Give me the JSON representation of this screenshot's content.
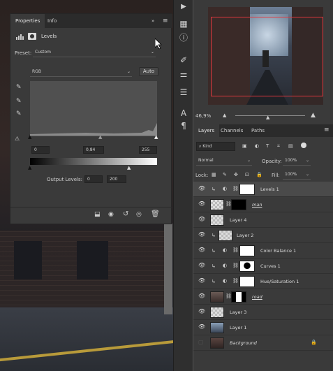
{
  "properties": {
    "tabs": [
      {
        "label": "Properties"
      },
      {
        "label": "Info"
      }
    ],
    "title": "Levels",
    "preset_label": "Preset:",
    "preset_value": "Custom",
    "channel": "RGB",
    "auto_label": "Auto",
    "input_levels": {
      "black": "0",
      "gamma": "0,84",
      "white": "255"
    },
    "output_label": "Output Levels:",
    "output_levels": {
      "black": "0",
      "white": "200"
    }
  },
  "navigator": {
    "zoom": "46,9%"
  },
  "layers_panel": {
    "tabs": [
      {
        "label": "Layers"
      },
      {
        "label": "Channels"
      },
      {
        "label": "Paths"
      }
    ],
    "filter_kind": "Kind",
    "blend_mode": "Normal",
    "opacity_label": "Opacity:",
    "opacity_value": "100%",
    "lock_label": "Lock:",
    "fill_label": "Fill:",
    "fill_value": "100%",
    "layers": [
      {
        "name": "Levels 1"
      },
      {
        "name": "man"
      },
      {
        "name": "Layer 4"
      },
      {
        "name": "Layer 2"
      },
      {
        "name": "Color Balance 1"
      },
      {
        "name": "Curves 1"
      },
      {
        "name": "Hue/Saturation 1"
      },
      {
        "name": "road"
      },
      {
        "name": "Layer 3"
      },
      {
        "name": "Layer 1"
      },
      {
        "name": "Background"
      }
    ]
  },
  "colors": {
    "accent_red": "#e0383e",
    "panel": "#3a3a3a",
    "dark": "#2b2b2b"
  }
}
